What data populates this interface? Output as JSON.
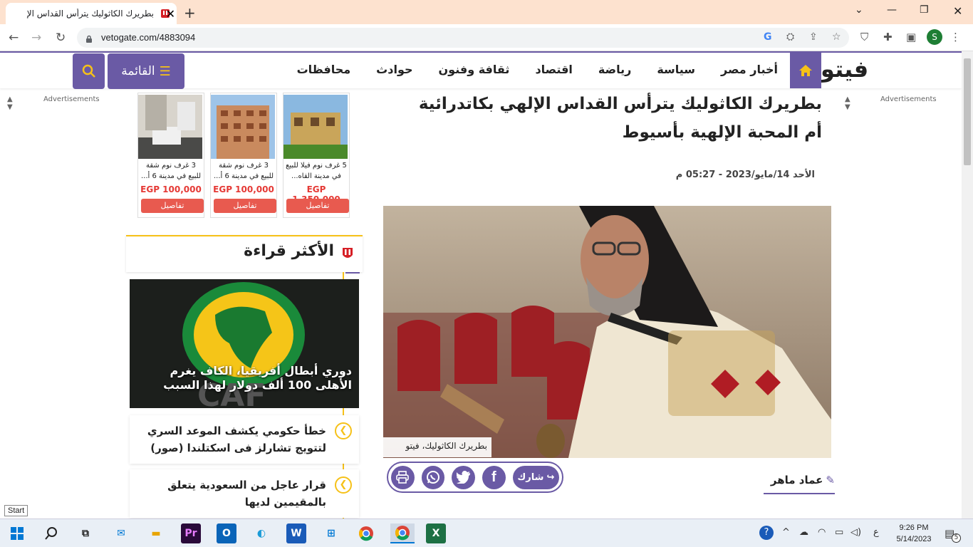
{
  "browser": {
    "tab_title": "بطريرك الكاثوليك يترأس القداس الإ",
    "url": "vetogate.com/4883094",
    "profile_initial": "S",
    "new_tab": "+",
    "close_tab": "✕"
  },
  "site": {
    "logo": "فيتو",
    "nav": [
      "أخبار مصر",
      "سياسة",
      "رياضة",
      "اقتصاد",
      "ثقافة وفنون",
      "حوادث",
      "محافظات"
    ],
    "menu_label": "القائمة",
    "ad_label_left": "Advertisements",
    "ad_label_right": "Advertisements"
  },
  "article": {
    "headline": "بطريرك الكاثوليك يترأس القداس الإلهي بكاتدرائية أم المحبة الإلهية بأسيوط",
    "date": "الأحد 14/مايو/2023 - 05:27 م",
    "caption": "بطريرك الكاثوليك، فيتو",
    "author": "عماد ماهر",
    "share_label": "شارك"
  },
  "ads": [
    {
      "title": "5 غرف نوم فيلا للبيع في مدينة القاه...",
      "price": "EGP 1,350,000",
      "button": "تفاصيل"
    },
    {
      "title": "3 غرف نوم شقة للبيع في مدينة 6 أ...",
      "price": "EGP 100,000",
      "button": "تفاصيل"
    },
    {
      "title": "3 غرف نوم شقة للبيع في مدينة 6 أ...",
      "price": "EGP 100,000",
      "button": "تفاصيل"
    }
  ],
  "most_read": {
    "title": "الأكثر قراءة",
    "featured": "دوري أبطال أفريقيا، الكاف يغرم الأهلى 100 ألف دولار لهذا السبب",
    "items": [
      "خطأ حكومي يكشف الموعد السري لتتويج تشارلز فى اسكتلندا (صور)",
      "قرار عاجل من السعودية يتعلق بالمقيمين لديها"
    ]
  },
  "taskbar": {
    "start_tooltip": "Start",
    "time": "9:26 PM",
    "date": "5/14/2023",
    "notifications": "5",
    "lang": "ع"
  },
  "colors": {
    "brand": "#6a5aa5",
    "accent": "#f6c118",
    "price": "#e53935"
  }
}
